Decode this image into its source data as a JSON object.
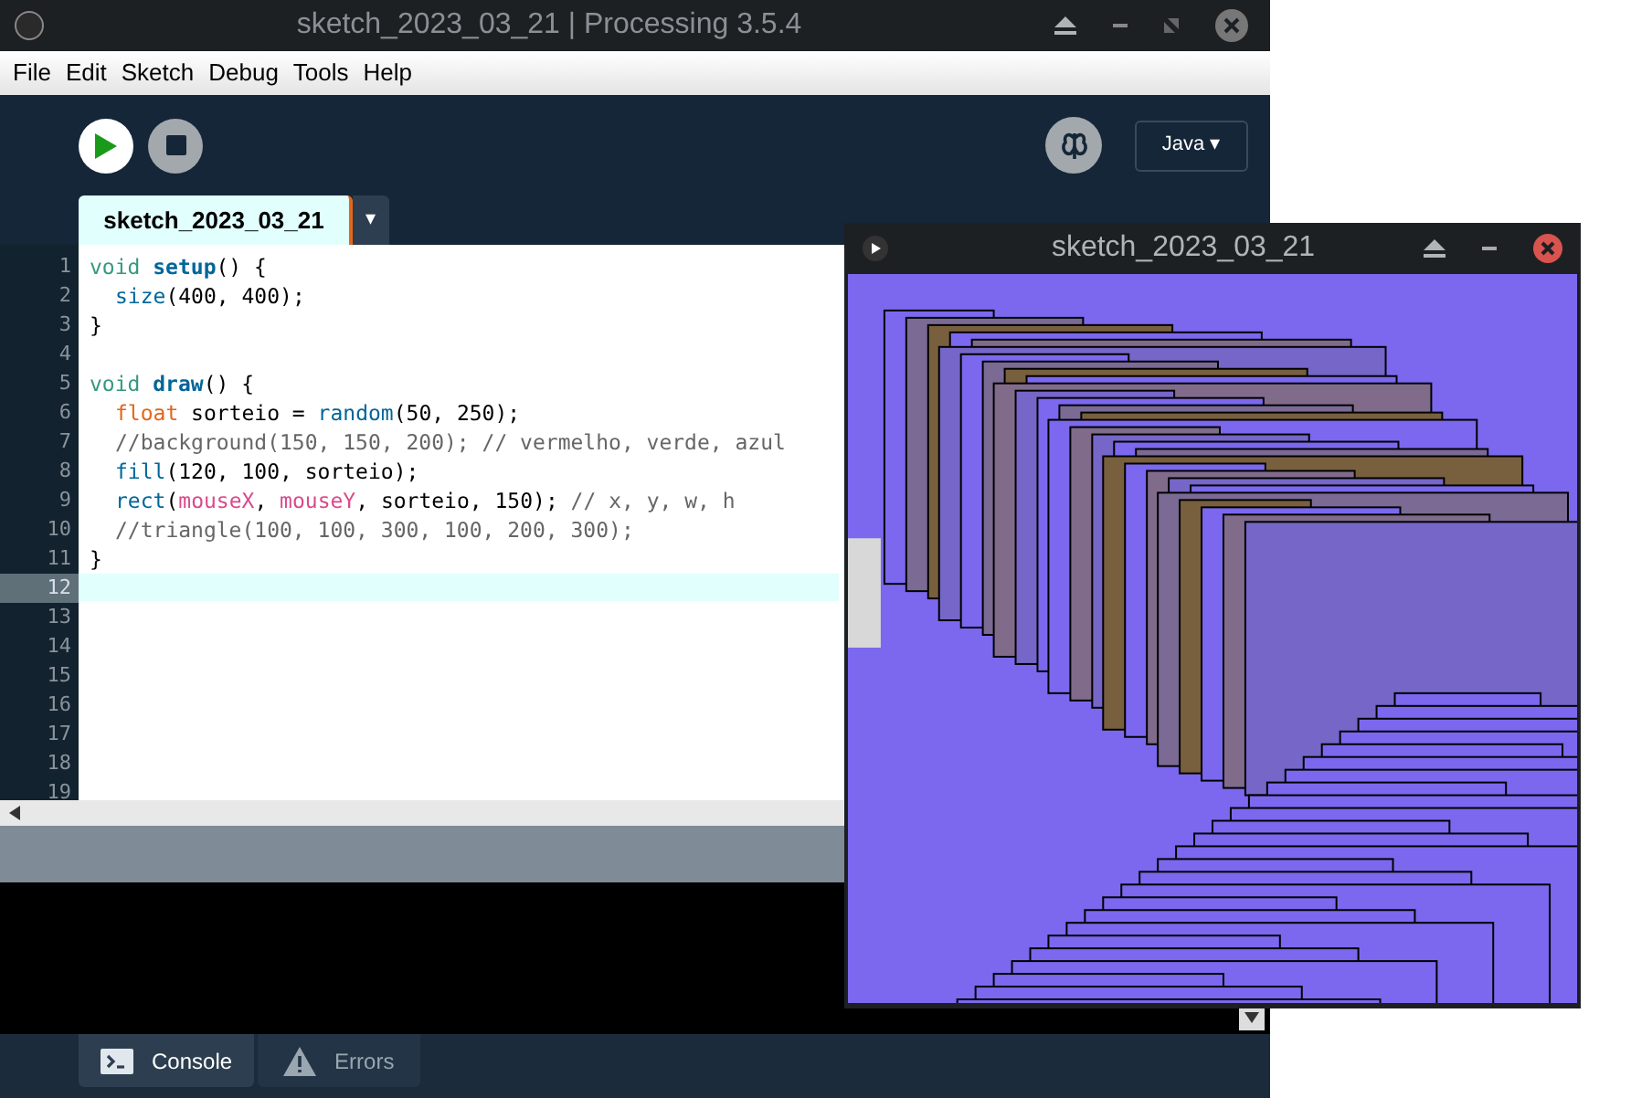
{
  "window": {
    "title": "sketch_2023_03_21 | Processing 3.5.4"
  },
  "menu": [
    "File",
    "Edit",
    "Sketch",
    "Debug",
    "Tools",
    "Help"
  ],
  "mode": {
    "label": "Java ▾"
  },
  "tabs": [
    {
      "label": "sketch_2023_03_21",
      "selected": true
    }
  ],
  "tab_menu": "▾",
  "editor": {
    "lines": [
      {
        "number": "1",
        "current": false,
        "indented": false,
        "segments": [
          {
            "kind": "keyword",
            "text": "void "
          },
          {
            "kind": "function",
            "text": "setup"
          },
          {
            "kind": "plain",
            "text": "() {"
          }
        ]
      },
      {
        "number": "2",
        "current": false,
        "indented": true,
        "segments": [
          {
            "kind": "call",
            "text": "size"
          },
          {
            "kind": "plain",
            "text": "(400, 400);"
          }
        ]
      },
      {
        "number": "3",
        "current": false,
        "indented": false,
        "segments": [
          {
            "kind": "plain",
            "text": "}"
          }
        ]
      },
      {
        "number": "4",
        "current": false
      },
      {
        "number": "5",
        "current": false,
        "indented": false,
        "segments": [
          {
            "kind": "keyword",
            "text": "void "
          },
          {
            "kind": "function",
            "text": "draw"
          },
          {
            "kind": "plain",
            "text": "() {"
          }
        ]
      },
      {
        "number": "6",
        "current": false,
        "indented": true,
        "segments": [
          {
            "kind": "type",
            "text": "float"
          },
          {
            "kind": "plain",
            "text": " sorteio = "
          },
          {
            "kind": "call",
            "text": "random"
          },
          {
            "kind": "plain",
            "text": "(50, 250);"
          }
        ]
      },
      {
        "number": "7",
        "current": false,
        "indented": true,
        "segments": [
          {
            "kind": "comment",
            "text": "//background(150, 150, 200); // vermelho, verde, azul"
          }
        ]
      },
      {
        "number": "8",
        "current": false,
        "indented": true,
        "segments": [
          {
            "kind": "call",
            "text": "fill"
          },
          {
            "kind": "plain",
            "text": "(120, 100, sorteio);"
          }
        ]
      },
      {
        "number": "9",
        "current": false,
        "indented": true,
        "segments": [
          {
            "kind": "call",
            "text": "rect"
          },
          {
            "kind": "plain",
            "text": "("
          },
          {
            "kind": "variable",
            "text": "mouseX"
          },
          {
            "kind": "plain",
            "text": ", "
          },
          {
            "kind": "variable",
            "text": "mouseY"
          },
          {
            "kind": "plain",
            "text": ", sorteio, 150); "
          },
          {
            "kind": "comment",
            "text": "// x, y, w, h"
          }
        ]
      },
      {
        "number": "10",
        "current": false,
        "indented": true,
        "segments": [
          {
            "kind": "comment",
            "text": "//triangle(100, 100, 300, 100, 200, 300);"
          }
        ]
      },
      {
        "number": "11",
        "current": false,
        "indented": false,
        "segments": [
          {
            "kind": "plain",
            "text": "}"
          }
        ]
      },
      {
        "number": "12",
        "current": true
      },
      {
        "number": "13",
        "current": false
      },
      {
        "number": "14",
        "current": false
      },
      {
        "number": "15",
        "current": false
      },
      {
        "number": "16",
        "current": false
      },
      {
        "number": "17",
        "current": false
      },
      {
        "number": "18",
        "current": false
      },
      {
        "number": "19",
        "current": false
      }
    ]
  },
  "console_tabs": [
    {
      "label": "Console",
      "selected": true
    },
    {
      "label": "Errors",
      "selected": false
    }
  ],
  "sketch_window": {
    "title": "sketch_2023_03_21"
  }
}
